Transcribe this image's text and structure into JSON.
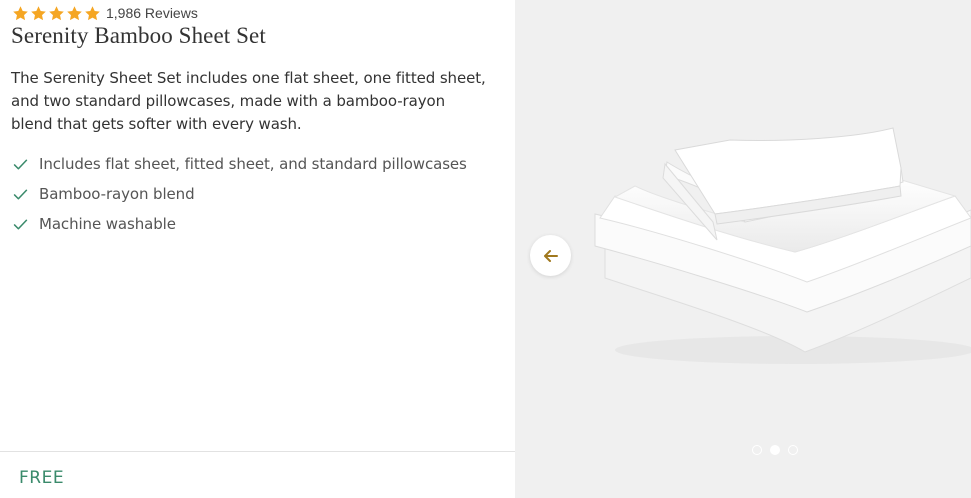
{
  "product": {
    "rating_stars": 5,
    "review_count": "1,986 Reviews",
    "title": "Serenity Bamboo Sheet Set",
    "description": "The Serenity Sheet Set includes one flat sheet, one fitted sheet, and two standard pillowcases, made with a bamboo-rayon blend that gets softer with every wash.",
    "features": [
      {
        "text": "Includes flat sheet, fitted sheet, and standard pillowcases"
      },
      {
        "text": "Bamboo-rayon blend"
      },
      {
        "text": "Machine washable"
      }
    ],
    "price": "FREE"
  },
  "gallery": {
    "image": "white-folded-sheets",
    "prev_icon": "arrow-left-icon",
    "dot_count": 3,
    "active_dot": 2
  },
  "colors": {
    "star": "#f5a623",
    "check": "#3a8a6b",
    "price": "#3a8a6b",
    "arrow": "#a0781e",
    "image_bg": "#f0f0f0"
  }
}
